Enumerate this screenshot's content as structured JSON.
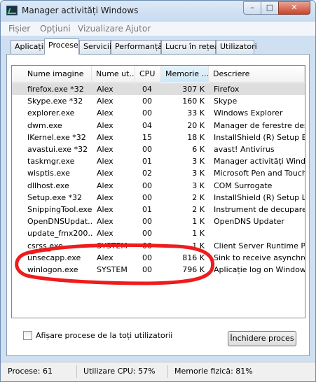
{
  "window": {
    "title": "Manager activități Windows",
    "minimize": "–",
    "maximize": "□",
    "close": "✕"
  },
  "menu": [
    "Fișier",
    "Opțiuni",
    "Vizualizare",
    "Ajutor"
  ],
  "tabs": [
    "Aplicații",
    "Procese",
    "Servicii",
    "Performanță",
    "Lucru în rețea",
    "Utilizatori"
  ],
  "active_tab": "Procese",
  "columns": [
    "Nume imagine",
    "Nume ut...",
    "CPU",
    "Memorie ...",
    "Descriere"
  ],
  "rows": [
    [
      "firefox.exe *32",
      "Alex",
      "04",
      "307 K",
      "Firefox"
    ],
    [
      "Skype.exe *32",
      "Alex",
      "00",
      "160 K",
      "Skype"
    ],
    [
      "explorer.exe",
      "Alex",
      "00",
      "33 K",
      "Windows Explorer"
    ],
    [
      "dwm.exe",
      "Alex",
      "04",
      "20 K",
      "Manager de ferestre des"
    ],
    [
      "IKernel.exe *32",
      "Alex",
      "15",
      "18 K",
      "InstallShield (R) Setup En"
    ],
    [
      "avastui.exe *32",
      "Alex",
      "00",
      "6 K",
      "avast! Antivirus"
    ],
    [
      "taskmgr.exe",
      "Alex",
      "01",
      "3 K",
      "Manager activități Windo"
    ],
    [
      "wisptis.exe",
      "Alex",
      "02",
      "3 K",
      "Microsoft Pen and Touch"
    ],
    [
      "dllhost.exe",
      "Alex",
      "00",
      "3 K",
      "COM Surrogate"
    ],
    [
      "Setup.exe *32",
      "Alex",
      "00",
      "2 K",
      "InstallShield (R) Setup La"
    ],
    [
      "SnippingTool.exe",
      "Alex",
      "01",
      "2 K",
      "Instrument de decupare"
    ],
    [
      "OpenDNSUpdat...",
      "Alex",
      "00",
      "1 K",
      "OpenDNS Updater"
    ],
    [
      "update_fmx200...",
      "Alex",
      "00",
      "1 K",
      ""
    ],
    [
      "csrss.exe",
      "SYSTEM",
      "00",
      "1 K",
      "Client Server Runtime Pr"
    ],
    [
      "unsecapp.exe",
      "Alex",
      "00",
      "816 K",
      "Sink to receive asynchro"
    ],
    [
      "winlogon.exe",
      "SYSTEM",
      "00",
      "796 K",
      "Aplicație log on Windows"
    ]
  ],
  "show_all_label": "Afișare procese de la toți utilizatorii",
  "end_process_label": "Închidere proces",
  "status": {
    "processes": "Procese: 61",
    "cpu": "Utilizare CPU: 57%",
    "memory": "Memorie fizică: 81%"
  },
  "colors": {
    "annotation": "#ee1c1c",
    "title_bg": "#cfe0f2",
    "sorted_column": "#d8ecf8"
  }
}
